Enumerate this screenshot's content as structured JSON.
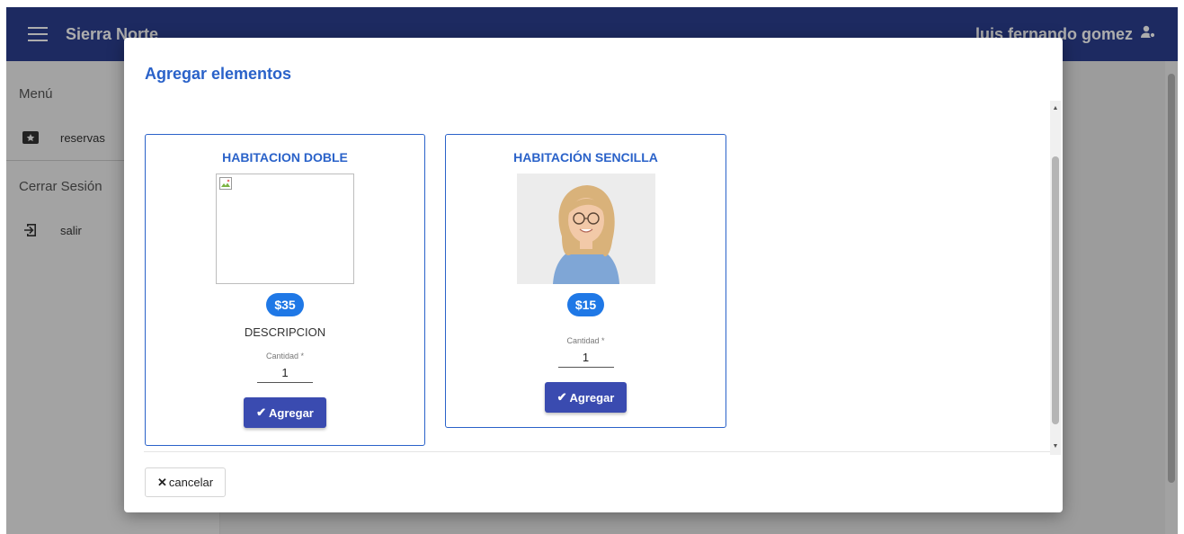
{
  "app": {
    "title": "Sierra Norte",
    "user": "luis fernando gomez"
  },
  "sidebar": {
    "menu_header": "Menú",
    "items": [
      {
        "label": "reservas",
        "icon": "ticket-star-icon"
      }
    ],
    "session_header": "Cerrar Sesión",
    "session_items": [
      {
        "label": "salir",
        "icon": "logout-icon"
      }
    ]
  },
  "dialog": {
    "title": "Agregar elementos",
    "cancel_label": "cancelar",
    "products": [
      {
        "name": "HABITACION DOBLE",
        "price": "$35",
        "description": "DESCRIPCION",
        "qty_label": "Cantidad *",
        "qty_value": "1",
        "add_label": "Agregar",
        "image": "broken"
      },
      {
        "name": "HABITACIÓN SENCILLA",
        "price": "$15",
        "description": "",
        "qty_label": "Cantidad *",
        "qty_value": "1",
        "add_label": "Agregar",
        "image": "woman-photo"
      }
    ]
  },
  "colors": {
    "topbar": "#2c3e8f",
    "accent": "#2a62c9",
    "price_badge": "#1f78e6",
    "button": "#3a4bb0"
  }
}
